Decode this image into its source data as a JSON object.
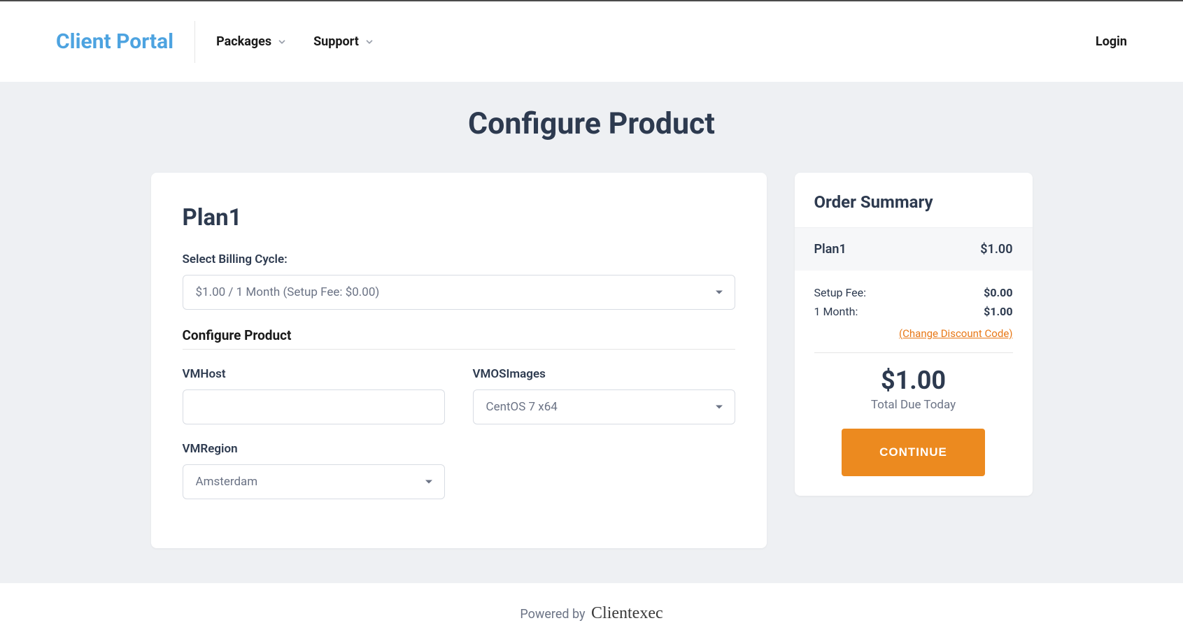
{
  "header": {
    "logo": "Client Portal",
    "nav": {
      "packages": "Packages",
      "support": "Support"
    },
    "login": "Login"
  },
  "page": {
    "title": "Configure Product"
  },
  "config": {
    "plan_name": "Plan1",
    "billing_cycle_label": "Select Billing Cycle:",
    "billing_cycle_value": "$1.00 / 1 Month (Setup Fee: $0.00)",
    "section_title": "Configure Product",
    "vmhost_label": "VMHost",
    "vmhost_value": "",
    "vmosimages_label": "VMOSImages",
    "vmosimages_value": "CentOS 7 x64",
    "vmregion_label": "VMRegion",
    "vmregion_value": "Amsterdam"
  },
  "summary": {
    "title": "Order Summary",
    "plan_name": "Plan1",
    "plan_price": "$1.00",
    "setup_fee_label": "Setup Fee:",
    "setup_fee_value": "$0.00",
    "period_label": "1 Month:",
    "period_value": "$1.00",
    "change_discount": "(Change Discount Code)",
    "total": "$1.00",
    "total_label": "Total Due Today",
    "continue": "CONTINUE"
  },
  "footer": {
    "powered_by": "Powered by",
    "brand": "Clientexec"
  }
}
